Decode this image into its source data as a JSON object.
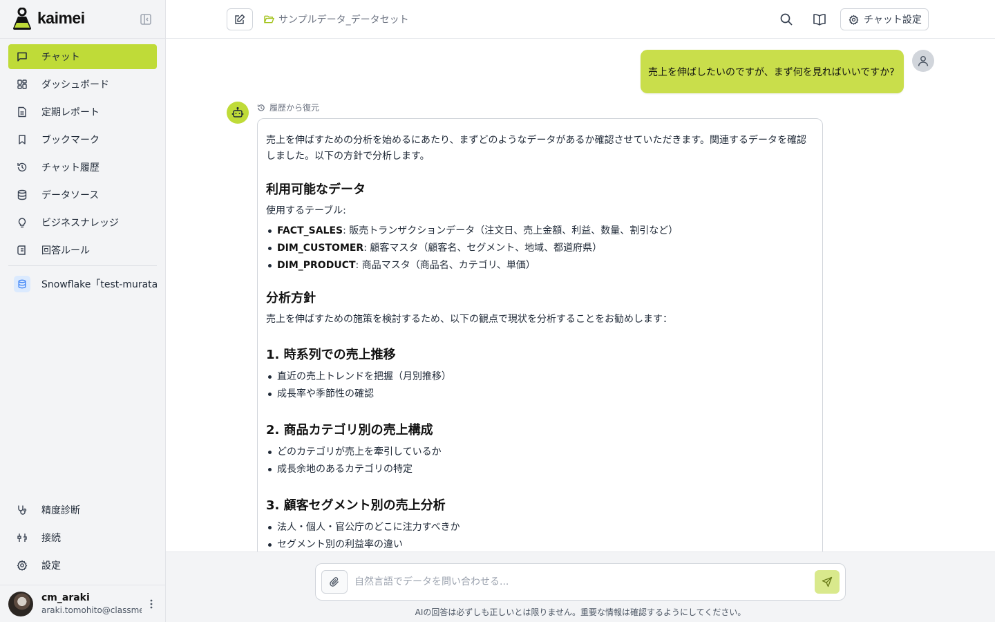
{
  "app": {
    "name": "kaimei",
    "accent": "#bfdb38"
  },
  "sidebar": {
    "items": [
      {
        "label": "チャット",
        "icon": "chat-icon",
        "active": true
      },
      {
        "label": "ダッシュボード",
        "icon": "dashboard-icon"
      },
      {
        "label": "定期レポート",
        "icon": "report-icon"
      },
      {
        "label": "ブックマーク",
        "icon": "bookmark-icon"
      },
      {
        "label": "チャット履歴",
        "icon": "history-icon"
      },
      {
        "label": "データソース",
        "icon": "database-icon"
      },
      {
        "label": "ビジネスナレッジ",
        "icon": "lightbulb-icon"
      },
      {
        "label": "回答ルール",
        "icon": "rules-icon"
      }
    ],
    "datasource": {
      "label": "Snowflake「test-murata」",
      "icon": "database-icon"
    },
    "bottom_items": [
      {
        "label": "精度診断",
        "icon": "stethoscope-icon"
      },
      {
        "label": "接続",
        "icon": "connection-icon"
      },
      {
        "label": "設定",
        "icon": "gear-icon"
      }
    ],
    "user": {
      "name": "cm_araki",
      "email": "araki.tomohito@classmethod.jp"
    }
  },
  "header": {
    "breadcrumb": "サンプルデータ_データセット",
    "settings_label": "チャット設定"
  },
  "chat": {
    "user_message": "売上を伸ばしたいのですが、まず何を見ればいいですか?",
    "restore_label": "履歴から復元",
    "answer": {
      "intro": "売上を伸ばすための分析を始めるにあたり、まずどのようなデータがあるか確認させていただきます。関連するデータを確認しました。以下の方針で分析します。",
      "data_heading": "利用可能なデータ",
      "tables_label": "使用するテーブル:",
      "tables": [
        {
          "name": "FACT_SALES",
          "desc": ": 販売トランザクションデータ（注文日、売上金額、利益、数量、割引など）"
        },
        {
          "name": "DIM_CUSTOMER",
          "desc": ": 顧客マスタ（顧客名、セグメント、地域、都道府県）"
        },
        {
          "name": "DIM_PRODUCT",
          "desc": ": 商品マスタ（商品名、カテゴリ、単価）"
        }
      ],
      "policy_heading": "分析方針",
      "policy_text": "売上を伸ばすための施策を検討するため、以下の観点で現状を分析することをお勧めします：",
      "sections": [
        {
          "title": "1. 時系列での売上推移",
          "bullets": [
            "直近の売上トレンドを把握（月別推移）",
            "成長率や季節性の確認"
          ]
        },
        {
          "title": "2. 商品カテゴリ別の売上構成",
          "bullets": [
            "どのカテゴリが売上を牽引しているか",
            "成長余地のあるカテゴリの特定"
          ]
        },
        {
          "title": "3. 顧客セグメント別の売上分析",
          "bullets": [
            "法人・個人・官公庁のどこに注力すべきか",
            "セグメント別の利益率の違い"
          ]
        }
      ]
    }
  },
  "composer": {
    "placeholder": "自然言語でデータを問い合わせる...",
    "disclaimer": "AIの回答は必ずしも正しいとは限りません。重要な情報は確認するようにしてください。"
  }
}
